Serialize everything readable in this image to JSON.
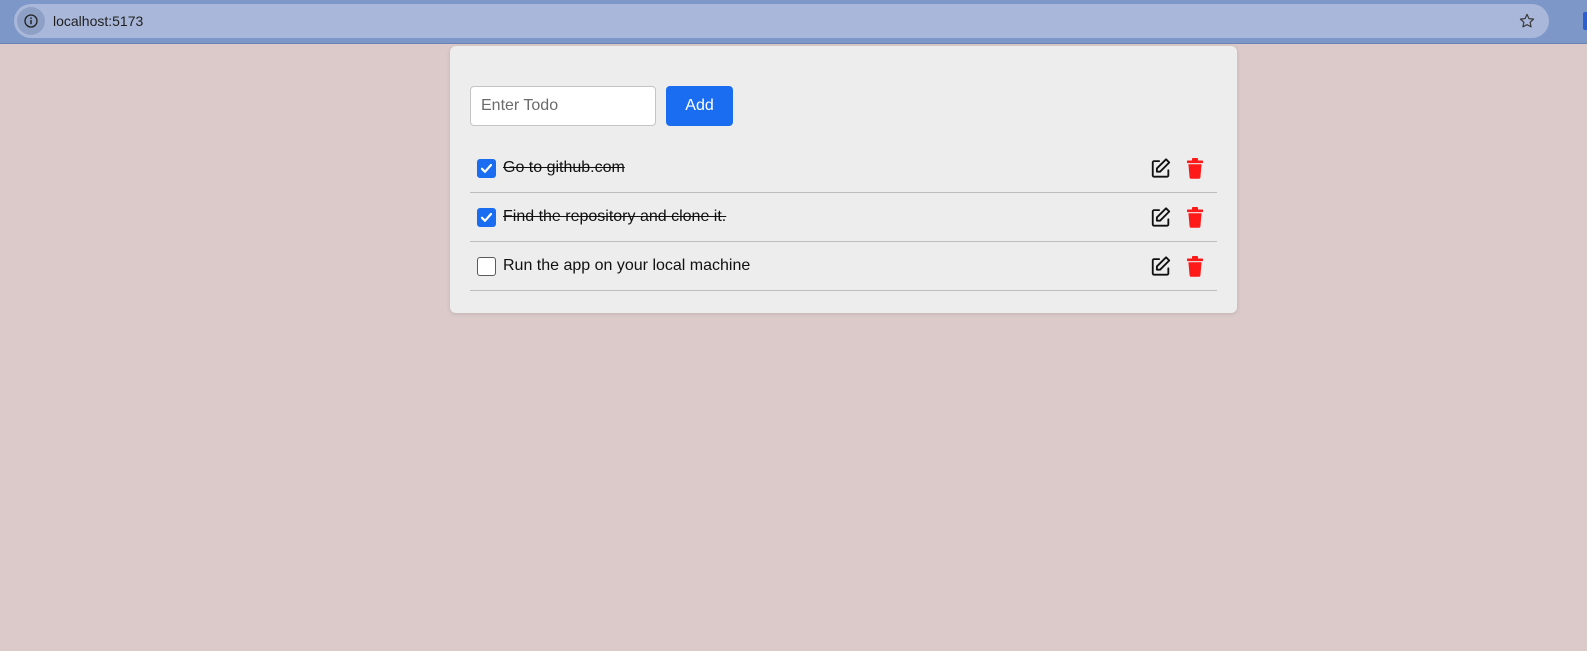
{
  "browser": {
    "url": "localhost:5173",
    "site_info_icon": "info-icon",
    "bookmark_icon": "star-icon"
  },
  "todo_form": {
    "placeholder": "Enter Todo",
    "value": "",
    "add_label": "Add"
  },
  "todos": [
    {
      "text": "Go to github.com",
      "completed": true
    },
    {
      "text": "Find the repository and clone it.",
      "completed": true
    },
    {
      "text": "Run the app on your local machine",
      "completed": false
    }
  ],
  "icons": {
    "edit": "pencil-edit-icon",
    "delete": "trash-icon"
  },
  "colors": {
    "page_background": "#dccaca",
    "card_background": "#ededed",
    "accent": "#1a6df0",
    "delete": "#ff1a1a",
    "browser_chrome": "#7d97c8"
  }
}
